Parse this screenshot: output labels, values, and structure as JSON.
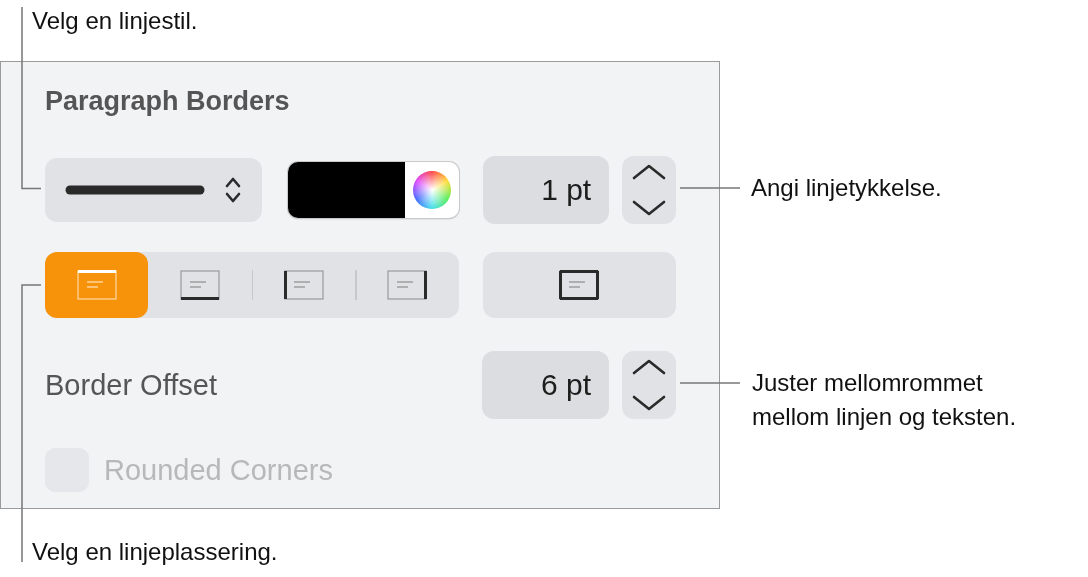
{
  "callouts": [
    {
      "text": "Velg en linjestil."
    },
    {
      "text": "Angi linjetykkelse."
    },
    {
      "text": "Juster mellomrommet mellom linjen og teksten."
    },
    {
      "text": "Velg en linjeplassering."
    }
  ],
  "panel": {
    "title": "Paragraph Borders",
    "line_style": {
      "kind": "solid"
    },
    "color_well": {
      "color": "#000000"
    },
    "thickness": {
      "value": "1 pt"
    },
    "positions": [
      {
        "kind": "top",
        "selected": true
      },
      {
        "kind": "bottom",
        "selected": false
      },
      {
        "kind": "left",
        "selected": false
      },
      {
        "kind": "right",
        "selected": false
      }
    ],
    "outline": {
      "kind": "all",
      "selected": false
    },
    "offset": {
      "label": "Border Offset",
      "value": "6 pt"
    },
    "rounded_corners": {
      "label": "Rounded Corners",
      "checked": false,
      "disabled": true
    }
  }
}
